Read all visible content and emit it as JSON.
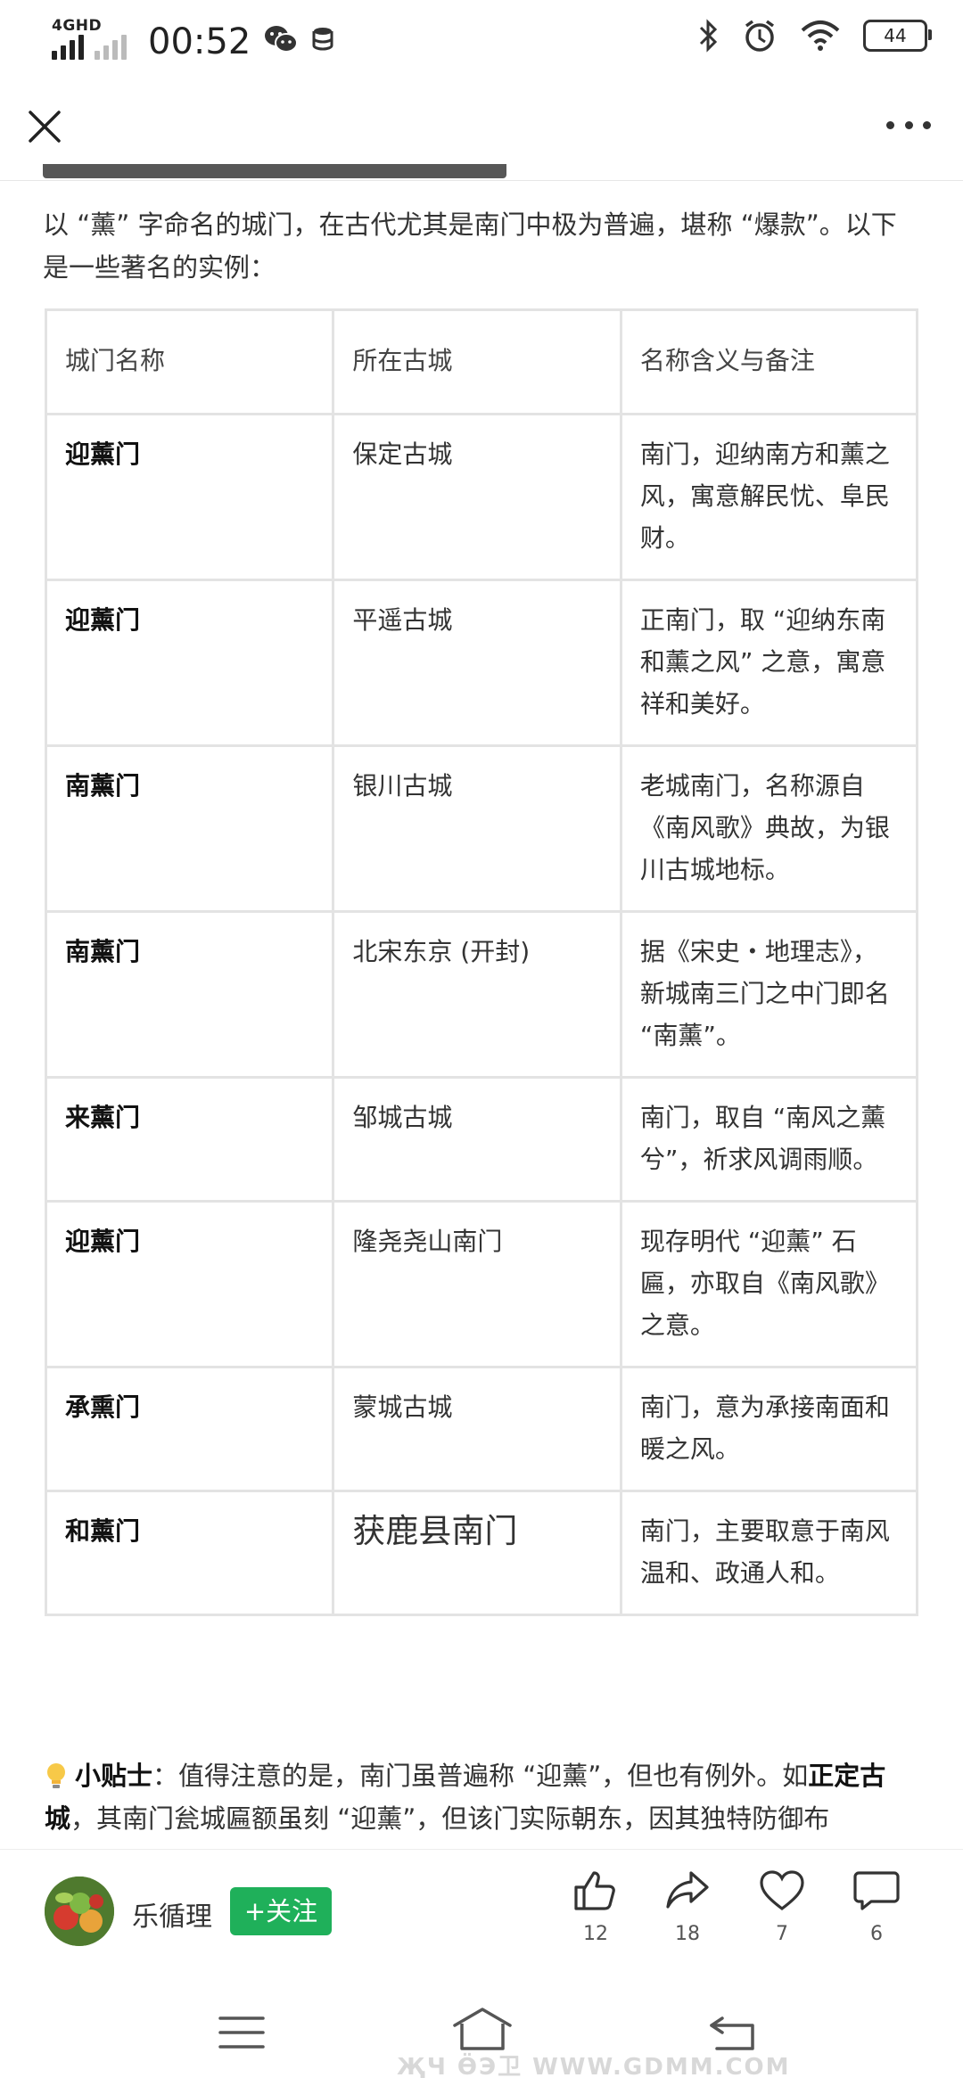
{
  "status_bar": {
    "network": "4GHD",
    "time": "00:52",
    "battery": "44"
  },
  "intro": "以 “薰” 字命名的城门，在古代尤其是南门中极为普遍，堪称 “爆款”。以下是一些著名的实例：",
  "table": {
    "headers": [
      "城门名称",
      "所在古城",
      "名称含义与备注"
    ],
    "rows": [
      {
        "gate": "迎薰门",
        "city": "保定古城",
        "note": "南门，迎纳南方和薰之风，寓意解民忧、阜民财。"
      },
      {
        "gate": "迎薰门",
        "city": "平遥古城",
        "note": "正南门，取 “迎纳东南和薰之风” 之意，寓意祥和美好。"
      },
      {
        "gate": "南薰门",
        "city": "银川古城",
        "note": "老城南门，名称源自《南风歌》典故，为银川古城地标。"
      },
      {
        "gate": "南薰门",
        "city": "北宋东京 (开封)",
        "note": "据《宋史・地理志》，新城南三门之中门即名 “南薰”。"
      },
      {
        "gate": "来薰门",
        "city": "邹城古城",
        "note": "南门，取自 “南风之薰兮”，祈求风调雨顺。"
      },
      {
        "gate": "迎薰门",
        "city": "隆尧尧山南门",
        "note": "现存明代 “迎薰” 石匾，亦取自《南风歌》之意。"
      },
      {
        "gate": "承熏门",
        "city": "蒙城古城",
        "note": "南门，意为承接南面和暖之风。"
      },
      {
        "gate": "和薰门",
        "city": "获鹿县南门",
        "note": "南门，主要取意于南风温和、政通人和。"
      }
    ]
  },
  "tip": {
    "label": "小贴士",
    "text1": "：值得注意的是，南门虽普遍称 “迎薰”，但也有例外。如",
    "bold2": "正定古城",
    "text2": "，其南门瓮城匾额虽刻 “迎薰”，但该门实际朝东，因其独特防御布"
  },
  "author": {
    "name": "乐循理",
    "follow_label": "+关注"
  },
  "actions": {
    "like": "12",
    "share": "18",
    "favorite": "7",
    "comment": "6"
  },
  "watermark": "ҖЧ ӪЭ卫 WWW.GDMM.COM",
  "colors": {
    "follow_green": "#1fb05a",
    "table_border": "#e3e3e3"
  }
}
